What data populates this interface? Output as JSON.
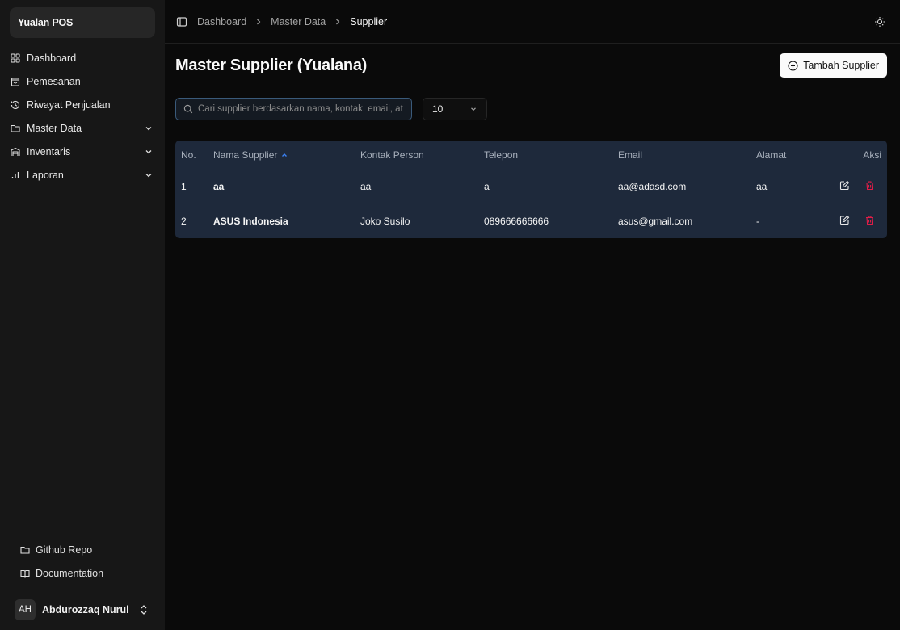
{
  "sidebar": {
    "brand": "Yualan POS",
    "items": [
      {
        "label": "Dashboard",
        "icon": "grid-icon"
      },
      {
        "label": "Pemesanan",
        "icon": "shopping-bag-icon"
      },
      {
        "label": "Riwayat Penjualan",
        "icon": "history-icon"
      },
      {
        "label": "Master Data",
        "icon": "folder-icon",
        "expandable": true
      },
      {
        "label": "Inventaris",
        "icon": "warehouse-icon",
        "expandable": true
      },
      {
        "label": "Laporan",
        "icon": "bar-chart-icon",
        "expandable": true
      }
    ],
    "bottom_links": [
      {
        "label": "Github Repo",
        "icon": "folder-icon"
      },
      {
        "label": "Documentation",
        "icon": "book-icon"
      }
    ],
    "user": {
      "initials": "AH",
      "name": "Abdurozzaq Nurul H..."
    }
  },
  "breadcrumb": [
    "Dashboard",
    "Master Data",
    "Supplier"
  ],
  "page": {
    "title": "Master Supplier (Yualana)",
    "add_button": "Tambah Supplier",
    "search_placeholder": "Cari supplier berdasarkan nama, kontak, email, atau...",
    "page_size": "10"
  },
  "table": {
    "headers": {
      "no": "No.",
      "name": "Nama Supplier",
      "contact": "Kontak Person",
      "phone": "Telepon",
      "email": "Email",
      "address": "Alamat",
      "actions": "Aksi"
    },
    "sort_column": "name",
    "sort_direction": "asc",
    "rows": [
      {
        "no": "1",
        "name": "aa",
        "contact": "aa",
        "phone": "a",
        "email": "aa@adasd.com",
        "address": "aa"
      },
      {
        "no": "2",
        "name": "ASUS Indonesia",
        "contact": "Joko Susilo",
        "phone": "089666666666",
        "email": "asus@gmail.com",
        "address": "-"
      }
    ]
  },
  "colors": {
    "accent_sort": "#3b82f6",
    "delete": "#e11d48",
    "table_bg": "#1e293b"
  }
}
